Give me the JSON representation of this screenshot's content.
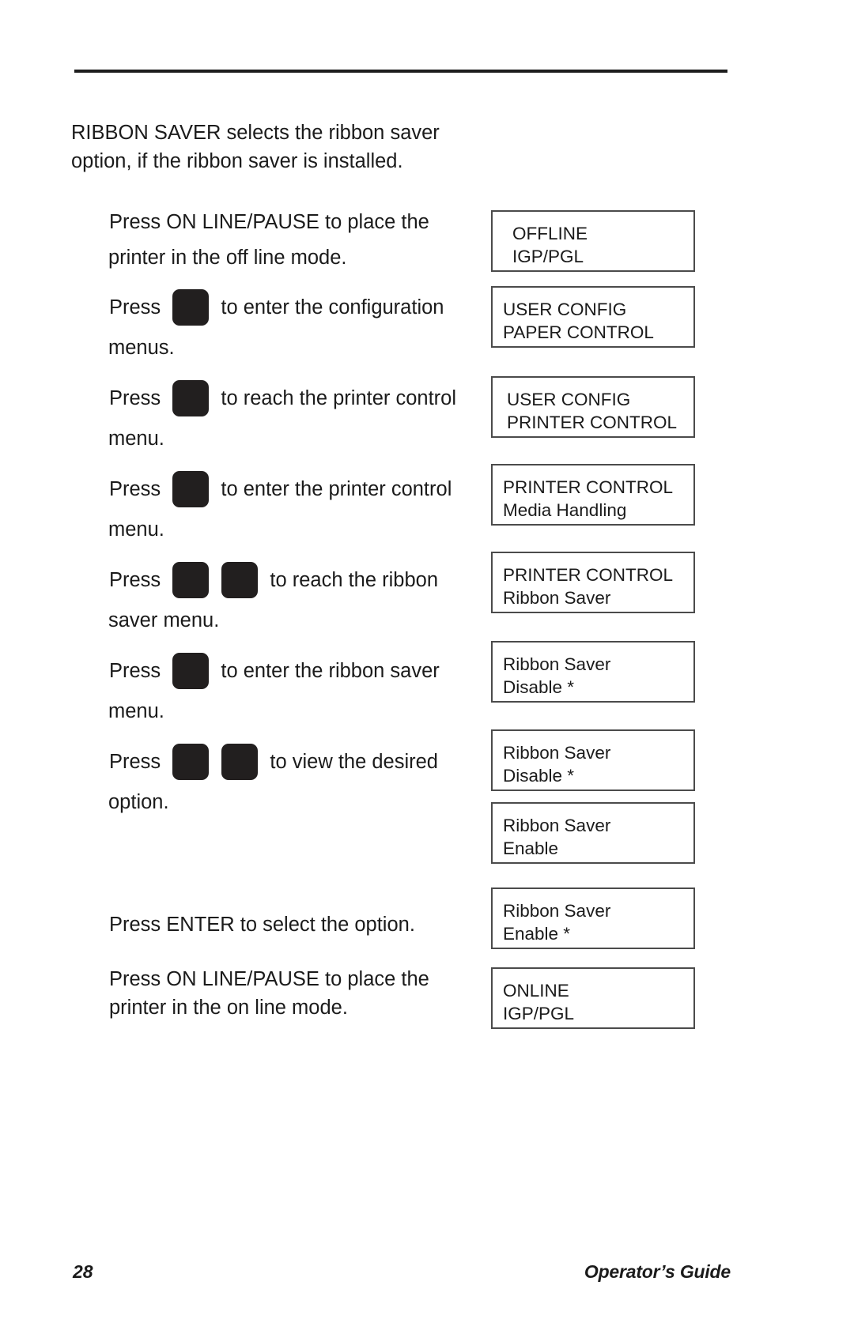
{
  "document": {
    "footer": {
      "page_number": "28",
      "guide_title": "Operator’s Guide"
    }
  },
  "intro": {
    "line1": "RIBBON SAVER selects the ribbon saver",
    "line2": "option, if the ribbon saver is installed."
  },
  "steps": [
    {
      "id": "step-online-pause-offline",
      "prefix": "Press ON LINE/PAUSE to place the",
      "icons": [],
      "suffix": "",
      "line2": "printer in the off line mode."
    },
    {
      "id": "step-down-enter-config",
      "prefix": "Press ",
      "icons": [
        "arrow-down"
      ],
      "suffix": " to enter the configuration",
      "line2": "menus."
    },
    {
      "id": "step-right-printer-control",
      "prefix": "Press ",
      "icons": [
        "arrow-right"
      ],
      "suffix": " to reach the printer control",
      "line2": "menu."
    },
    {
      "id": "step-down-enter-printer-control",
      "prefix": "Press ",
      "icons": [
        "arrow-down"
      ],
      "suffix": " to enter the printer control",
      "line2": "menu."
    },
    {
      "id": "step-left-right-ribbon-saver",
      "prefix": "Press ",
      "icons": [
        "arrow-left",
        "arrow-right"
      ],
      "suffix": " to reach the ribbon",
      "line2": "saver menu."
    },
    {
      "id": "step-down-enter-ribbon-saver",
      "prefix": "Press ",
      "icons": [
        "arrow-down"
      ],
      "suffix": " to enter the ribbon saver",
      "line2": "menu."
    },
    {
      "id": "step-left-right-view-option",
      "prefix": "Press ",
      "icons": [
        "arrow-left",
        "arrow-right"
      ],
      "suffix": " to view the desired",
      "line2": "option."
    }
  ],
  "tail": [
    {
      "id": "tail-enter-select",
      "line1": "Press ENTER to select the option."
    },
    {
      "id": "tail-online-pause-online",
      "line1": "Press ON LINE/PAUSE to place the",
      "line2": "printer in the on line mode."
    }
  ],
  "lcd_boxes": [
    {
      "id": "lcd-offline-igp-pgl",
      "line1": "OFFLINE",
      "line2": "IGP/PGL"
    },
    {
      "id": "lcd-user-config-paper-control",
      "line1": "USER CONFIG",
      "line2": "PAPER CONTROL"
    },
    {
      "id": "lcd-user-config-printer-control",
      "line1": "USER CONFIG",
      "line2": "PRINTER CONTROL"
    },
    {
      "id": "lcd-printer-control-media",
      "line1": "PRINTER CONTROL",
      "line2": "Media Handling"
    },
    {
      "id": "lcd-printer-control-ribbon",
      "line1": "PRINTER CONTROL",
      "line2": "Ribbon Saver"
    },
    {
      "id": "lcd-ribbon-saver-disable-1",
      "line1": "Ribbon Saver",
      "line2": "Disable *"
    },
    {
      "id": "lcd-ribbon-saver-disable-2",
      "line1": "Ribbon Saver",
      "line2": "Disable *"
    },
    {
      "id": "lcd-ribbon-saver-enable",
      "line1": "Ribbon Saver",
      "line2": "Enable"
    },
    {
      "id": "lcd-ribbon-saver-enable-star",
      "line1": "Ribbon Saver",
      "line2": "Enable *"
    },
    {
      "id": "lcd-online-igp-pgl",
      "line1": "ONLINE",
      "line2": "IGP/PGL"
    }
  ],
  "colors": {
    "ink": "#1b1b1b",
    "rule": "#1d1d1d",
    "lcd_border": "#4b4b4b",
    "keycap": "#221f1f",
    "arrow": "#ffffff",
    "paper": "#ffffff"
  }
}
